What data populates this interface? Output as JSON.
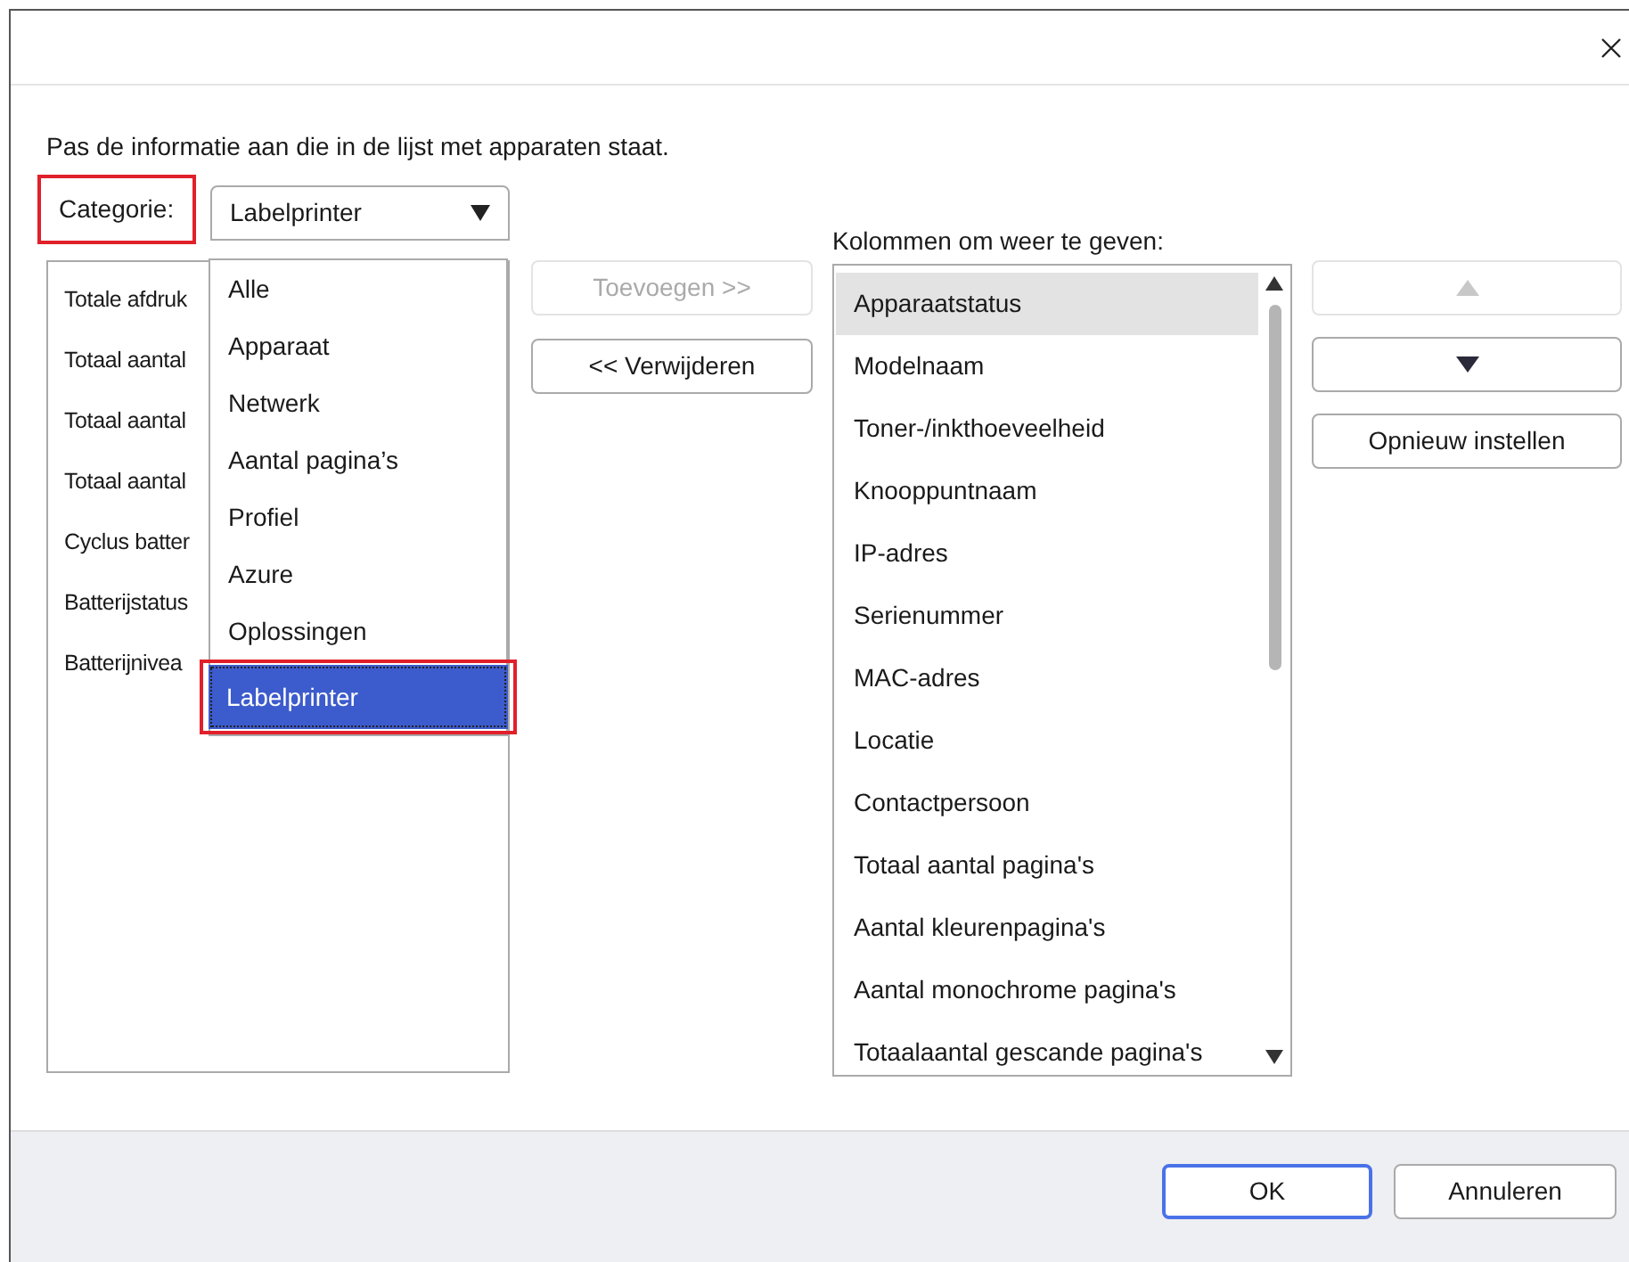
{
  "instruction": "Pas de informatie aan die in de lijst met apparaten staat.",
  "category": {
    "label": "Categorie:",
    "label_marked": true,
    "value": "Labelprinter",
    "expanded": true,
    "options": [
      {
        "label": "Alle",
        "selected": false,
        "marked": false
      },
      {
        "label": "Apparaat",
        "selected": false,
        "marked": false
      },
      {
        "label": "Netwerk",
        "selected": false,
        "marked": false
      },
      {
        "label": "Aantal pagina’s",
        "selected": false,
        "marked": false
      },
      {
        "label": "Profiel",
        "selected": false,
        "marked": false
      },
      {
        "label": "Azure",
        "selected": false,
        "marked": false
      },
      {
        "label": "Oplossingen",
        "selected": false,
        "marked": false
      },
      {
        "label": "Labelprinter",
        "selected": true,
        "marked": true
      }
    ]
  },
  "available": {
    "items": [
      {
        "label": "Totale afdruk",
        "selected": false
      },
      {
        "label": "Totaal aantal",
        "selected": false
      },
      {
        "label": "Totaal aantal",
        "selected": false
      },
      {
        "label": "Totaal aantal",
        "selected": false
      },
      {
        "label": "Cyclus batter",
        "selected": false
      },
      {
        "label": "Batterijstatus",
        "selected": false
      },
      {
        "label": "Batterijnivea",
        "selected": false
      }
    ]
  },
  "middle_buttons": [
    {
      "label": "Toevoegen >>",
      "disabled": true
    },
    {
      "label": "<< Verwijderen",
      "disabled": false
    }
  ],
  "columns": {
    "label": "Kolommen om weer te geven:",
    "items": [
      {
        "label": "Apparaatstatus",
        "selected": true
      },
      {
        "label": "Modelnaam",
        "selected": false
      },
      {
        "label": "Toner-/inkthoeveelheid",
        "selected": false
      },
      {
        "label": "Knooppuntnaam",
        "selected": false
      },
      {
        "label": "IP-adres",
        "selected": false
      },
      {
        "label": "Serienummer",
        "selected": false
      },
      {
        "label": "MAC-adres",
        "selected": false
      },
      {
        "label": "Locatie",
        "selected": false
      },
      {
        "label": "Contactpersoon",
        "selected": false
      },
      {
        "label": "Totaal aantal pagina's",
        "selected": false
      },
      {
        "label": "Aantal kleurenpagina's",
        "selected": false
      },
      {
        "label": "Aantal monochrome pagina's",
        "selected": false
      },
      {
        "label": "Totaalaantal gescande pagina's",
        "selected": false
      }
    ]
  },
  "move_buttons": [
    {
      "kind": "up",
      "disabled": true
    },
    {
      "kind": "down",
      "disabled": false
    }
  ],
  "reset_button": {
    "label": "Opnieuw instellen"
  },
  "footer_buttons": [
    {
      "label": "OK",
      "default": true
    },
    {
      "label": "Annuleren",
      "default": false
    }
  ]
}
